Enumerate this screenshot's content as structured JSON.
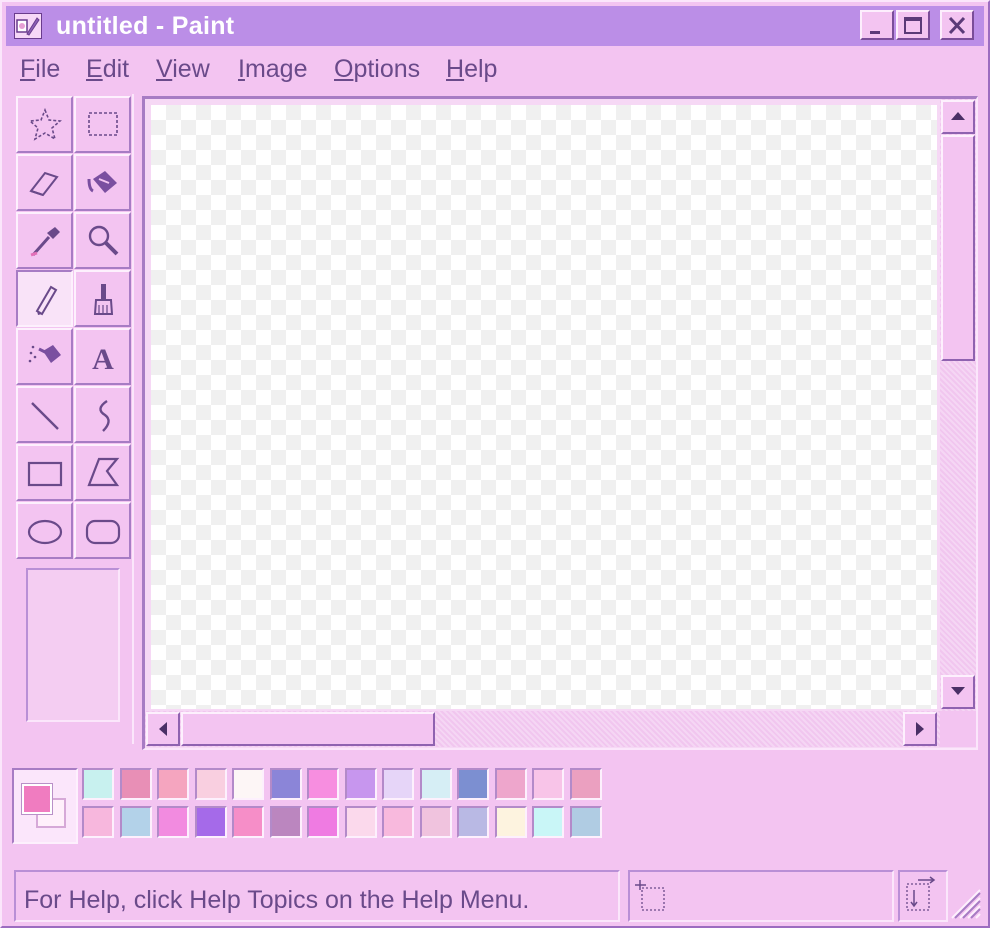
{
  "window": {
    "title": "untitled - Paint",
    "icon": "paint-app-icon"
  },
  "menu": [
    {
      "label": "File",
      "mnemonic": "F",
      "rest": "ile"
    },
    {
      "label": "Edit",
      "mnemonic": "E",
      "rest": "dit"
    },
    {
      "label": "View",
      "mnemonic": "V",
      "rest": "iew"
    },
    {
      "label": "Image",
      "mnemonic": "I",
      "rest": "mage"
    },
    {
      "label": "Options",
      "mnemonic": "O",
      "rest": "ptions"
    },
    {
      "label": "Help",
      "mnemonic": "H",
      "rest": "elp"
    }
  ],
  "tools": [
    {
      "name": "free-form-select-icon",
      "active": false
    },
    {
      "name": "select-icon",
      "active": false
    },
    {
      "name": "eraser-icon",
      "active": false
    },
    {
      "name": "fill-with-color-icon",
      "active": false
    },
    {
      "name": "pick-color-icon",
      "active": false
    },
    {
      "name": "magnifier-icon",
      "active": false
    },
    {
      "name": "pencil-icon",
      "active": true
    },
    {
      "name": "brush-icon",
      "active": false
    },
    {
      "name": "airbrush-icon",
      "active": false
    },
    {
      "name": "text-icon",
      "active": false
    },
    {
      "name": "line-icon",
      "active": false
    },
    {
      "name": "curve-icon",
      "active": false
    },
    {
      "name": "rectangle-icon",
      "active": false
    },
    {
      "name": "polygon-icon",
      "active": false
    },
    {
      "name": "ellipse-icon",
      "active": false
    },
    {
      "name": "rounded-rectangle-icon",
      "active": false
    }
  ],
  "text_tool_glyph": "A",
  "colors": {
    "foreground": "#f07cc0",
    "background": "#fff0fb"
  },
  "palette": [
    [
      "#c8f1ef",
      "#e88fb6",
      "#f5a5bf",
      "#f9cfe0",
      "#fdf6f6",
      "#8b85d8",
      "#f78ee0",
      "#c796ee",
      "#e6d5f8",
      "#d6eef5",
      "#7c8fd1",
      "#eea6cc",
      "#f8c4e8",
      "#eba0c0"
    ],
    [
      "#f7b7dd",
      "#b3d2e9",
      "#f28be0",
      "#a56ae9",
      "#f68ec8",
      "#bb86bf",
      "#ef7be2",
      "#fbd9ec",
      "#f8b9dd",
      "#f0c3de",
      "#b9b9e4",
      "#fdf3df",
      "#c9f6f7",
      "#b0cce3"
    ]
  ],
  "status": {
    "help_text": "For Help, click Help Topics on the Help Menu."
  }
}
